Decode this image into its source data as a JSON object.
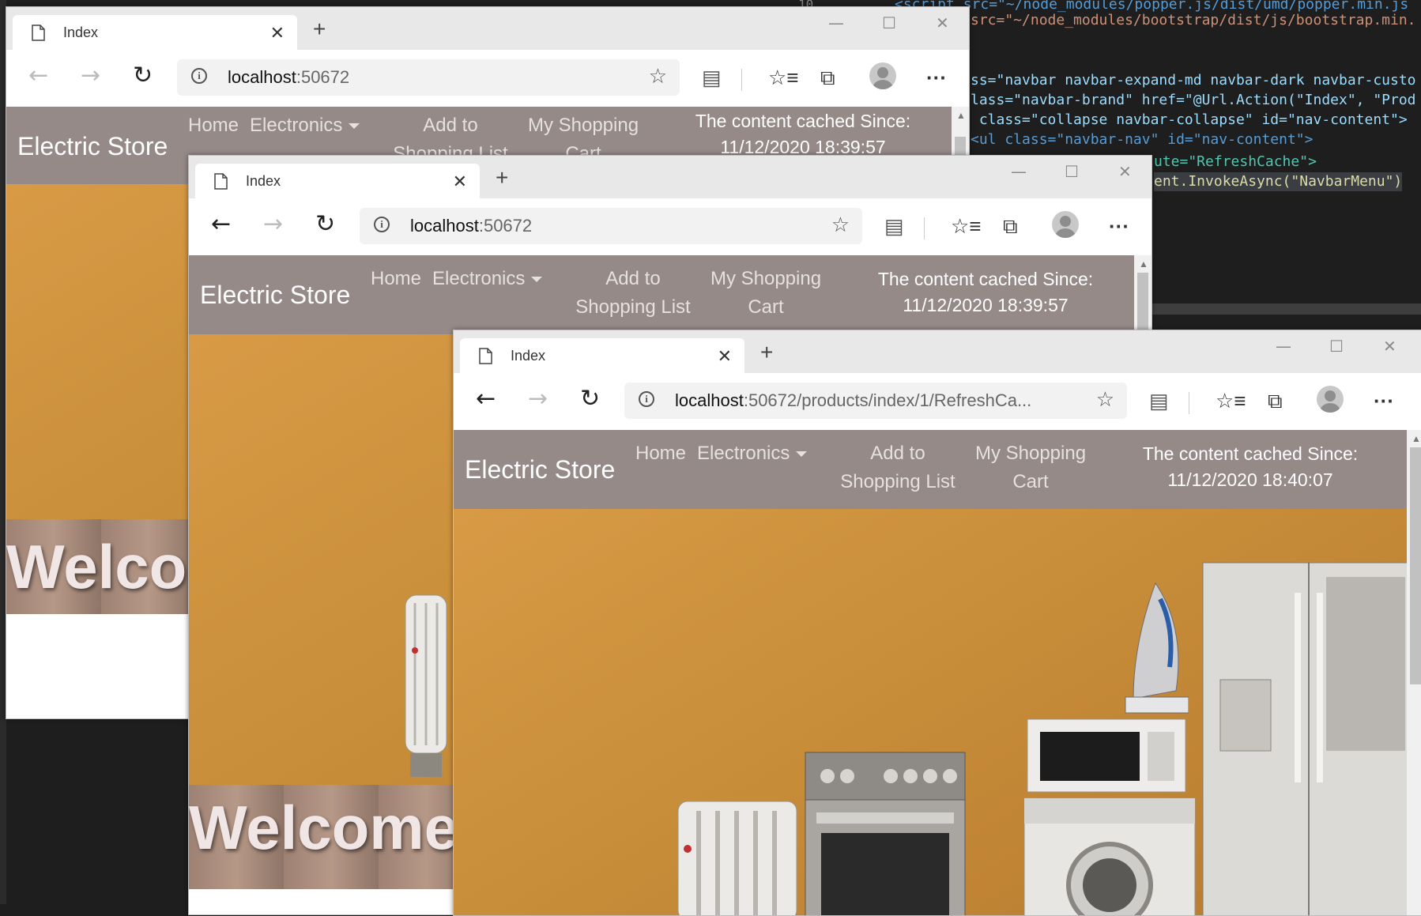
{
  "editor": {
    "line_number": "10",
    "lines": [
      "<script src=\"~/node_modules/popper.js/dist/umd/popper.min.js",
      "src=\"~/node_modules/bootstrap/dist/js/bootstrap.min.",
      "ss=\"navbar navbar-expand-md navbar-dark navbar-custo",
      "lass=\"navbar-brand\" href=\"@Url.Action(\"Index\", \"Prod",
      " class=\"collapse navbar-collapse\" id=\"nav-content\">",
      "<ul class=\"navbar-nav\" id=\"nav-content\">",
      "ute=\"RefreshCache\">",
      "ent.InvokeAsync(\"NavbarMenu\")"
    ]
  },
  "windows": [
    {
      "tab_title": "Index",
      "url_host": "localhost",
      "url_rest": ":50672",
      "brand": "Electric Store",
      "nav": {
        "home": "Home",
        "electronics": "Electronics",
        "add_line1": "Add to",
        "add_line2": "Shopping List",
        "cart_line1": "My Shopping",
        "cart_line2": "Cart"
      },
      "cached_label": "The content cached Since:",
      "cached_time": "11/12/2020 18:39:57",
      "welcome": "Welcome"
    },
    {
      "tab_title": "Index",
      "url_host": "localhost",
      "url_rest": ":50672",
      "brand": "Electric Store",
      "nav": {
        "home": "Home",
        "electronics": "Electronics",
        "add_line1": "Add to",
        "add_line2": "Shopping List",
        "cart_line1": "My Shopping",
        "cart_line2": "Cart"
      },
      "cached_label": "The content cached Since:",
      "cached_time": "11/12/2020 18:39:57",
      "welcome": "Welcome"
    },
    {
      "tab_title": "Index",
      "url_host": "localhost",
      "url_rest": ":50672/products/index/1/RefreshCa...",
      "brand": "Electric Store",
      "nav": {
        "home": "Home",
        "electronics": "Electronics",
        "add_line1": "Add to",
        "add_line2": "Shopping List",
        "cart_line1": "My Shopping",
        "cart_line2": "Cart"
      },
      "cached_label": "The content cached Since:",
      "cached_time": "11/12/2020 18:40:07"
    }
  ],
  "icons": {
    "back": "←",
    "forward": "→",
    "refresh": "↻",
    "star": "☆",
    "favorites": "☆≡",
    "collections": "⧉",
    "more": "···",
    "close": "✕",
    "new_tab": "+",
    "minimize": "—",
    "maximize": "☐"
  },
  "colors": {
    "navbar": "#958a88",
    "hero": "#d89a45",
    "editor_bg": "#1e1e1e"
  }
}
